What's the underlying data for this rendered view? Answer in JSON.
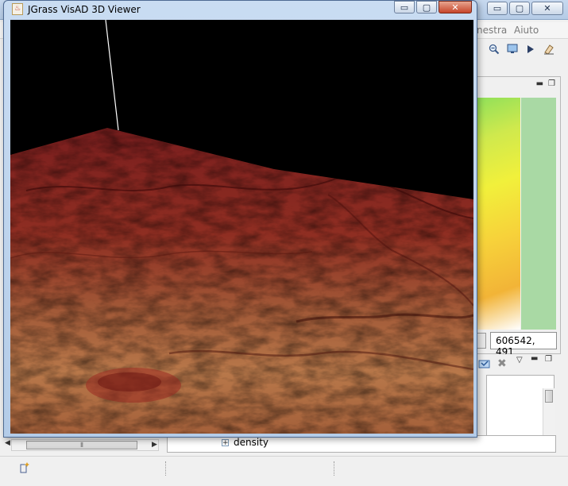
{
  "main_window": {
    "menu": {
      "visible_items": [
        "nestra",
        "Aiuto"
      ]
    },
    "toolbar": {
      "icons": [
        "zoom-out-icon",
        "monitor-icon",
        "arrow-right-icon",
        "eraser-icon"
      ]
    },
    "coordinate_readout": "606542, 491",
    "tree": {
      "items": [
        {
          "label": "density"
        }
      ]
    },
    "controls": {
      "minimize": "▭",
      "maximize": "▢",
      "close": "✕"
    }
  },
  "visad_window": {
    "title": "JGrass VisAD 3D Viewer",
    "app_icon": "java-icon",
    "controls": {
      "minimize": "▭",
      "maximize": "▢",
      "close": "✕"
    },
    "scene": "3D terrain rendering in red-brown shading",
    "colors": {
      "terrain_dark": "#7a1e1e",
      "terrain_mid": "#a8452c",
      "terrain_light": "#b8784a",
      "background": "#000000"
    }
  }
}
